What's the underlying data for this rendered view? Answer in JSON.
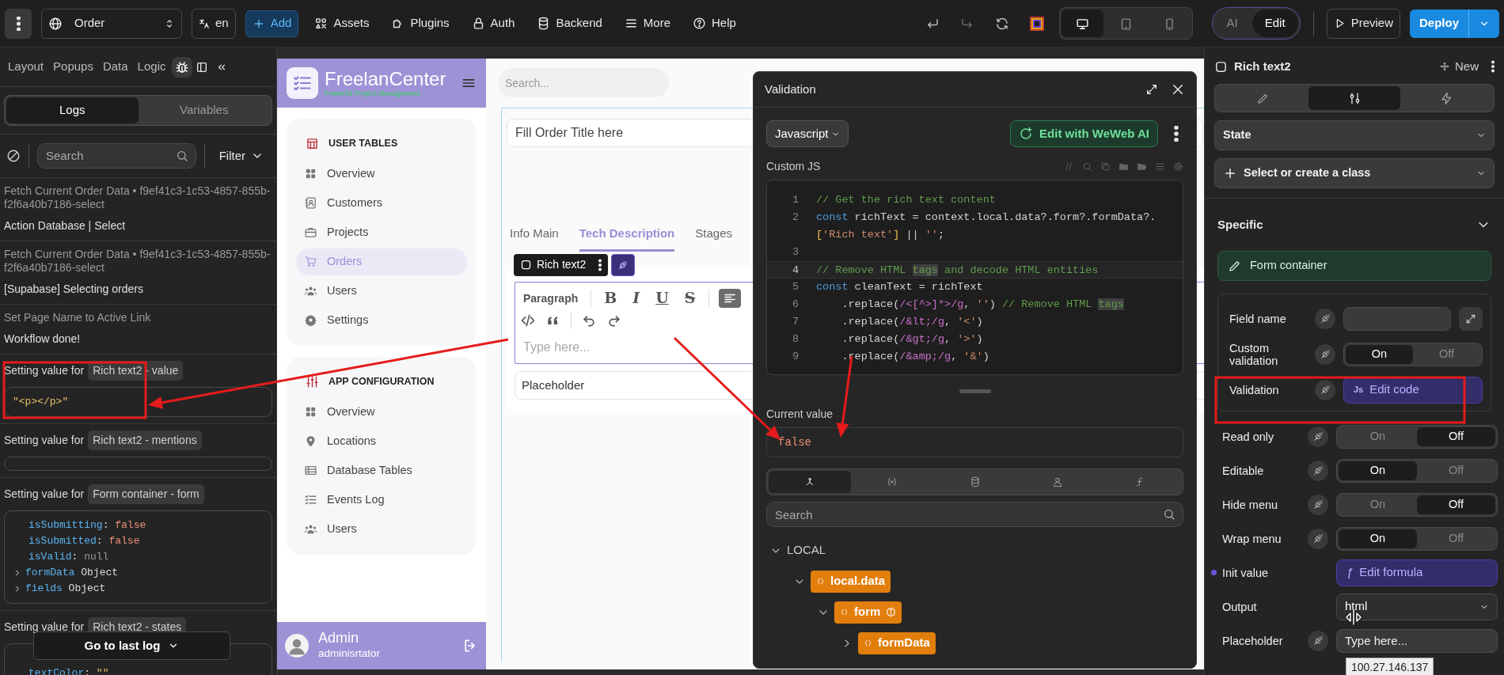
{
  "topbar": {
    "page_select": "Order",
    "language": "en",
    "add_button": "Add",
    "menu": [
      "Assets",
      "Plugins",
      "Auth",
      "Backend",
      "More",
      "Help"
    ],
    "devices": [
      {
        "selected": true
      },
      {
        "selected": false
      },
      {
        "selected": false
      }
    ],
    "modes": [
      {
        "label": "AI",
        "selected": false
      },
      {
        "label": "Edit",
        "selected": true
      }
    ],
    "preview_button": "Preview",
    "deploy_button": "Deploy"
  },
  "left_panel": {
    "tabs": [
      {
        "kind": "text",
        "label": "Layout",
        "selected": false
      },
      {
        "kind": "text",
        "label": "Popups",
        "selected": false
      },
      {
        "kind": "text",
        "label": "Data",
        "selected": false
      },
      {
        "kind": "text",
        "label": "Logic",
        "selected": false
      },
      {
        "kind": "debug",
        "selected": true
      }
    ],
    "subtabs": [
      {
        "label": "Logs",
        "selected": true
      },
      {
        "label": "Variables",
        "selected": false
      }
    ],
    "search": {
      "placeholder": "Search"
    },
    "filter": "Filter",
    "logs": [
      {
        "kind": "message",
        "title": "Fetch Current Order Data • f9ef41c3-1c53-4857-855b-f2f6a40b7186-select",
        "message": "Action Database | Select"
      },
      {
        "kind": "message",
        "title": "Fetch Current Order Data • f9ef41c3-1c53-4857-855b-f2f6a40b7186-select",
        "message": "[Supabase] Selecting orders"
      },
      {
        "kind": "message",
        "title": "Set Page Name to Active Link",
        "message": "Workflow done!"
      },
      {
        "kind": "value",
        "title": "Setting value for",
        "tag": "Rich text2 - value",
        "value": "\"<p></p>\""
      },
      {
        "kind": "value",
        "title": "Setting value for",
        "tag": "Rich text2 - mentions"
      },
      {
        "kind": "value",
        "title": "Setting value for",
        "tag": "Form container - form",
        "lines": [
          {
            "expandable": false,
            "segments": [
              {
                "text": "isSubmitting",
                "kind": "key"
              },
              {
                "text": ": ",
                "kind": "plain"
              },
              {
                "text": "false",
                "kind": "boolean"
              }
            ]
          },
          {
            "expandable": false,
            "segments": [
              {
                "text": "isSubmitted",
                "kind": "key"
              },
              {
                "text": ": ",
                "kind": "plain"
              },
              {
                "text": "false",
                "kind": "boolean"
              }
            ]
          },
          {
            "expandable": false,
            "segments": [
              {
                "text": "isValid",
                "kind": "key"
              },
              {
                "text": ": ",
                "kind": "plain"
              },
              {
                "text": "null",
                "kind": "null"
              }
            ]
          },
          {
            "expandable": true,
            "segments": [
              {
                "text": "formData",
                "kind": "key"
              },
              {
                "text": " Object",
                "kind": "object"
              }
            ]
          },
          {
            "expandable": true,
            "segments": [
              {
                "text": "fields",
                "kind": "key"
              },
              {
                "text": " Object",
                "kind": "object"
              }
            ]
          }
        ]
      },
      {
        "kind": "value",
        "title": "Setting value for",
        "tag": "Rich text2 - states",
        "lines": [
          {
            "expandable": false,
            "segments": [
              {
                "text": "textColor",
                "kind": "key"
              },
              {
                "text": ": ",
                "kind": "plain"
              },
              {
                "text": "\"\"",
                "kind": "string"
              }
            ]
          }
        ]
      }
    ],
    "go_to_last": "Go to last log"
  },
  "app": {
    "brand": "FreelanCenter",
    "tagline": "Powerful Project Management",
    "sections": [
      {
        "title": "USER TABLES",
        "items": [
          {
            "label": "Overview",
            "selected": false
          },
          {
            "label": "Customers",
            "selected": false
          },
          {
            "label": "Projects",
            "selected": false
          },
          {
            "label": "Orders",
            "selected": true
          },
          {
            "label": "Users",
            "selected": false
          },
          {
            "label": "Settings",
            "selected": false
          }
        ]
      },
      {
        "title": "APP CONFIGURATION",
        "items": [
          {
            "label": "Overview",
            "selected": false
          },
          {
            "label": "Locations",
            "selected": false
          },
          {
            "label": "Database Tables",
            "selected": false
          },
          {
            "label": "Events Log",
            "selected": false
          },
          {
            "label": "Users",
            "selected": false
          }
        ]
      }
    ],
    "user": {
      "name": "Admin",
      "role": "adminisrtator"
    },
    "search": {
      "placeholder": "Search..."
    },
    "title_field": {
      "placeholder": "Fill Order Title here"
    },
    "tabs": [
      {
        "label": "Info Main",
        "selected": false
      },
      {
        "label": "Tech Description",
        "selected": true
      },
      {
        "label": "Stages",
        "selected": false
      }
    ],
    "element_chip": "Rich text2",
    "editor": {
      "block_type": "Paragraph",
      "format_buttons": [
        "B",
        "I",
        "U",
        "S"
      ],
      "align_active": true,
      "placeholder": "Type here..."
    },
    "second_field": {
      "placeholder": "Placeholder"
    }
  },
  "validation_modal": {
    "title": "Validation",
    "language": "Javascript",
    "ai_button": "Edit with WeWeb AI",
    "section_label": "Custom JS",
    "code": [
      {
        "number": "1",
        "active": false,
        "segments": [
          {
            "text": "// Get the rich text content",
            "kind": "comment"
          }
        ]
      },
      {
        "number": "2",
        "active": false,
        "segments": [
          {
            "text": "const",
            "kind": "keyword"
          },
          {
            "text": " richText = context.local.data?.form?.formData?.",
            "kind": "plain"
          }
        ]
      },
      {
        "active": false,
        "segments": [
          {
            "text": "[",
            "kind": "punct"
          },
          {
            "text": "'Rich text'",
            "kind": "string"
          },
          {
            "text": "]",
            "kind": "punct"
          },
          {
            "text": " || ",
            "kind": "plain"
          },
          {
            "text": "''",
            "kind": "string"
          },
          {
            "text": ";",
            "kind": "plain"
          }
        ]
      },
      {
        "number": "3",
        "active": false
      },
      {
        "number": "4",
        "active": true,
        "segments": [
          {
            "text": "// Remove HTML ",
            "kind": "comment"
          },
          {
            "text": "tags",
            "kind": "match"
          },
          {
            "text": " and decode HTML entities",
            "kind": "comment"
          }
        ]
      },
      {
        "number": "5",
        "active": false,
        "segments": [
          {
            "text": "const",
            "kind": "keyword"
          },
          {
            "text": " cleanText = richText",
            "kind": "plain"
          }
        ]
      },
      {
        "number": "6",
        "active": false,
        "segments": [
          {
            "text": "    .replace(",
            "kind": "plain"
          },
          {
            "text": "/<[^>]*>/g",
            "kind": "regex"
          },
          {
            "text": ", ",
            "kind": "plain"
          },
          {
            "text": "''",
            "kind": "string"
          },
          {
            "text": ") ",
            "kind": "plain"
          },
          {
            "text": "// Remove HTML ",
            "kind": "comment"
          },
          {
            "text": "tags",
            "kind": "match"
          }
        ]
      },
      {
        "number": "7",
        "active": false,
        "segments": [
          {
            "text": "    .replace(",
            "kind": "plain"
          },
          {
            "text": "/&lt;/g",
            "kind": "regex"
          },
          {
            "text": ", ",
            "kind": "plain"
          },
          {
            "text": "'<'",
            "kind": "string"
          },
          {
            "text": ")",
            "kind": "plain"
          }
        ]
      },
      {
        "number": "8",
        "active": false,
        "segments": [
          {
            "text": "    .replace(",
            "kind": "plain"
          },
          {
            "text": "/&gt;/g",
            "kind": "regex"
          },
          {
            "text": ", ",
            "kind": "plain"
          },
          {
            "text": "'>'",
            "kind": "string"
          },
          {
            "text": ")",
            "kind": "plain"
          }
        ]
      },
      {
        "number": "9",
        "active": false,
        "segments": [
          {
            "text": "    .replace(",
            "kind": "plain"
          },
          {
            "text": "/&amp;/g",
            "kind": "regex"
          },
          {
            "text": ", ",
            "kind": "plain"
          },
          {
            "text": "'&'",
            "kind": "string"
          },
          {
            "text": ")",
            "kind": "plain"
          }
        ]
      }
    ],
    "current_value_label": "Current value",
    "current_value": "false",
    "explorer_tabs": [
      {
        "selected": true
      },
      {
        "selected": false
      },
      {
        "selected": false
      },
      {
        "selected": false
      },
      {
        "selected": false
      }
    ],
    "search": {
      "placeholder": "Search"
    },
    "tree": [
      {
        "label": "LOCAL",
        "kind": "section",
        "expanded": true,
        "children": [
          {
            "label": "local.data",
            "kind": "object",
            "expanded": true,
            "info": false,
            "children": [
              {
                "label": "form",
                "kind": "object",
                "expanded": true,
                "info": true,
                "children": [
                  {
                    "label": "formData",
                    "kind": "object",
                    "expanded": false,
                    "info": false
                  }
                ]
              }
            ]
          }
        ]
      }
    ]
  },
  "properties": {
    "element": "Rich text2",
    "new_button": "New",
    "tabs": [
      {
        "selected": false
      },
      {
        "selected": true
      },
      {
        "selected": false
      }
    ],
    "state_select": "State",
    "class_select": "Select or create a class",
    "section": {
      "title": "Specific",
      "expanded": true
    },
    "form_container_button": "Form container",
    "form_rows": [
      {
        "label": "Field name",
        "kind": "input",
        "bindable": true
      },
      {
        "label": "Custom validation",
        "kind": "toggle",
        "bindable": true,
        "options": [
          {
            "label": "On",
            "selected": true
          },
          {
            "label": "Off",
            "selected": false
          }
        ]
      },
      {
        "label": "Validation",
        "kind": "code",
        "bindable": true,
        "badge": "Js",
        "button": "Edit code"
      }
    ],
    "rows": [
      {
        "label": "Read only",
        "kind": "toggle",
        "bindable": true,
        "bound": false,
        "options": [
          {
            "label": "On",
            "selected": false
          },
          {
            "label": "Off",
            "selected": true
          }
        ]
      },
      {
        "label": "Editable",
        "kind": "toggle",
        "bindable": true,
        "bound": false,
        "options": [
          {
            "label": "On",
            "selected": true
          },
          {
            "label": "Off",
            "selected": false
          }
        ]
      },
      {
        "label": "Hide menu",
        "kind": "toggle",
        "bindable": true,
        "bound": false,
        "options": [
          {
            "label": "On",
            "selected": false
          },
          {
            "label": "Off",
            "selected": true
          }
        ]
      },
      {
        "label": "Wrap menu",
        "kind": "toggle",
        "bindable": true,
        "bound": false,
        "options": [
          {
            "label": "On",
            "selected": true
          },
          {
            "label": "Off",
            "selected": false
          }
        ]
      },
      {
        "label": "Init value",
        "kind": "formula",
        "bindable": false,
        "bound": true,
        "symbol": "ƒ",
        "button": "Edit formula"
      },
      {
        "label": "Output",
        "kind": "select",
        "bindable": false,
        "bound": false,
        "value": "html"
      },
      {
        "label": "Placeholder",
        "kind": "input",
        "bindable": true,
        "bound": false,
        "value": "Type here..."
      }
    ],
    "tooltip": "100.27.146.137"
  }
}
